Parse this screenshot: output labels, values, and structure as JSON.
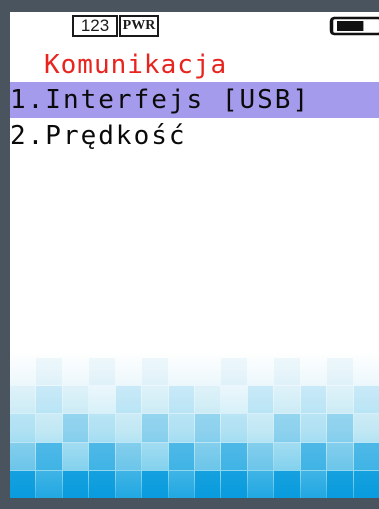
{
  "status_bar": {
    "input_mode_label": "123",
    "power_label": "PWR",
    "battery_icon": "battery-icon",
    "battery_level": 0.66
  },
  "screen": {
    "title": "Komunikacja",
    "menu_items": [
      {
        "label": "1.Interfejs [USB]",
        "selected": true
      },
      {
        "label": "2.Prędkość",
        "selected": false
      }
    ]
  },
  "colors": {
    "title": "#e8241f",
    "selection": "#a59bec",
    "frame": "#4a545e",
    "tile_accent": "#1aa3e0"
  }
}
